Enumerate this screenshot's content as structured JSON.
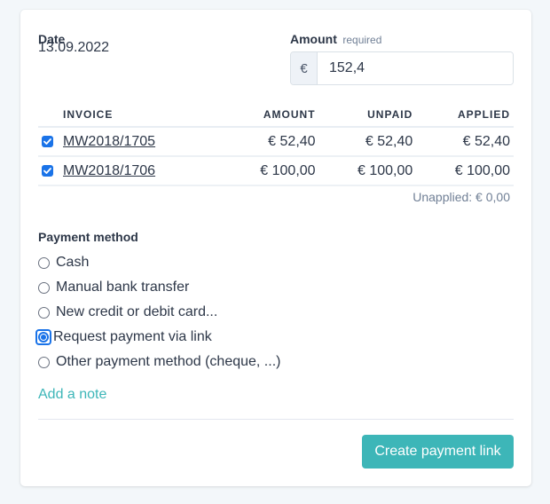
{
  "form": {
    "date_label": "Date",
    "date_value": "13.09.2022",
    "amount_label": "Amount",
    "amount_required": "required",
    "currency_symbol": "€",
    "amount_value": "152,4"
  },
  "invoices": {
    "headers": [
      "INVOICE",
      "AMOUNT",
      "UNPAID",
      "APPLIED"
    ],
    "rows": [
      {
        "checked": true,
        "invoice": "MW2018/1705",
        "amount": "€ 52,40",
        "unpaid": "€ 52,40",
        "applied": "€ 52,40"
      },
      {
        "checked": true,
        "invoice": "MW2018/1706",
        "amount": "€ 100,00",
        "unpaid": "€ 100,00",
        "applied": "€ 100,00"
      }
    ],
    "unapplied": "Unapplied: € 0,00"
  },
  "payment_method": {
    "label": "Payment method",
    "options": [
      {
        "label": "Cash",
        "selected": false
      },
      {
        "label": "Manual bank transfer",
        "selected": false
      },
      {
        "label": "New credit or debit card...",
        "selected": false
      },
      {
        "label": "Request payment via link",
        "selected": true
      },
      {
        "label": "Other payment method (cheque, ...)",
        "selected": false
      }
    ]
  },
  "add_note_label": "Add a note",
  "submit_label": "Create payment link",
  "colors": {
    "accent": "#3db6b8",
    "checkbox": "#1a73e8",
    "page_bg": "#f3f7fa"
  }
}
